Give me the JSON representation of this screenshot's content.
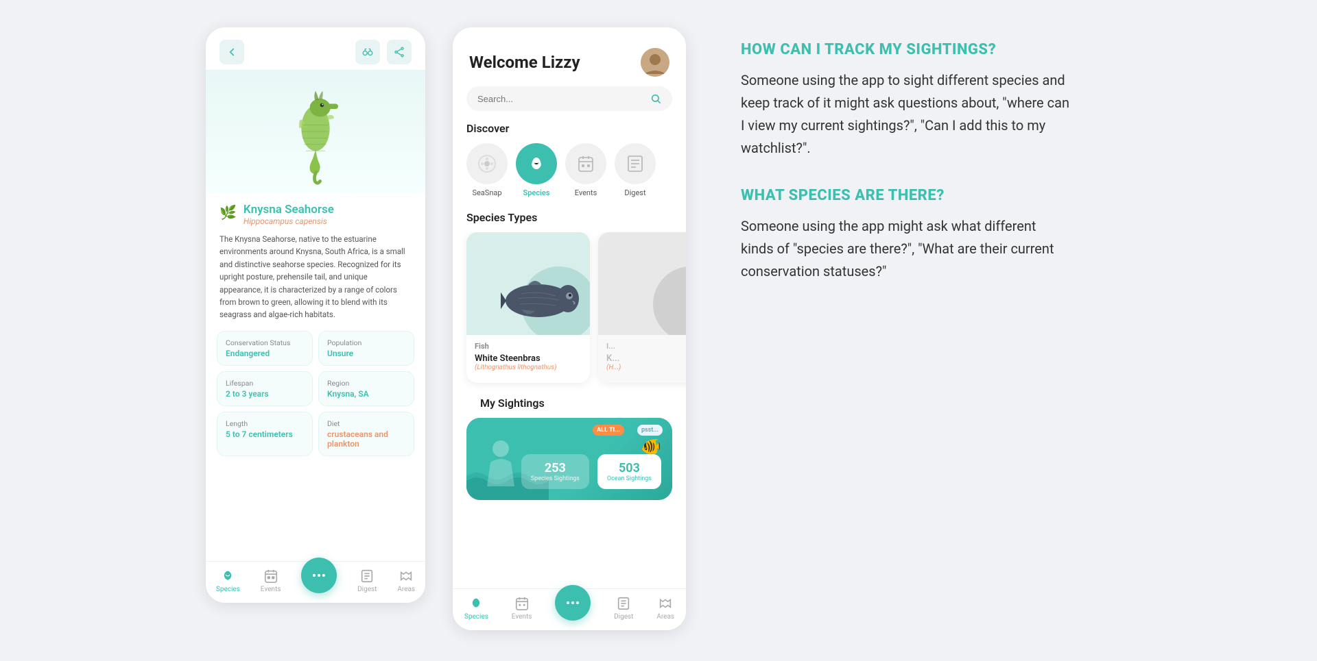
{
  "phone1": {
    "species_name": "Knysna Seahorse",
    "latin_name": "Hippocampus capensis",
    "description": "The Knysna Seahorse, native to the estuarine environments around Knysna, South Africa, is a small and distinctive seahorse species. Recognized for its upright posture, prehensile tail, and unique appearance, it is characterized by a range of colors from brown to green, allowing it to blend with its seagrass and algae-rich habitats.",
    "stats": [
      {
        "label": "Conservation Status",
        "value": "Endangered",
        "color": "teal"
      },
      {
        "label": "Population",
        "value": "Unsure",
        "color": "teal"
      },
      {
        "label": "Lifespan",
        "value": "2 to 3 years",
        "color": "teal"
      },
      {
        "label": "Region",
        "value": "Knysna, SA",
        "color": "teal"
      },
      {
        "label": "Length",
        "value": "5 to 7 centimeters",
        "color": "teal"
      },
      {
        "label": "Diet",
        "value": "crustaceans and plankton",
        "color": "orange"
      }
    ],
    "nav": [
      {
        "label": "Species",
        "active": true
      },
      {
        "label": "Events",
        "active": false
      },
      {
        "label": "Digest",
        "active": false
      },
      {
        "label": "Areas",
        "active": false
      }
    ]
  },
  "phone2": {
    "welcome_text": "Welcome Lizzy",
    "search_placeholder": "Search...",
    "discover_label": "Discover",
    "categories": [
      {
        "label": "SeaSnap",
        "icon": "🔵",
        "active": false
      },
      {
        "label": "Species",
        "icon": "🐢",
        "active": true
      },
      {
        "label": "Events",
        "icon": "📅",
        "active": false
      },
      {
        "label": "Digest",
        "icon": "📖",
        "active": false
      }
    ],
    "species_types_label": "Species Types",
    "species": [
      {
        "name": "Fish",
        "common": "White Steenbras",
        "latin": "Lithognathus lithognathus"
      },
      {
        "name": "I...",
        "common": "K...",
        "latin": "H..."
      }
    ],
    "my_sightings_label": "My Sightings",
    "sightings_stats": [
      {
        "value": "253",
        "label": "Species Sightings",
        "highlight": false
      },
      {
        "value": "503",
        "label": "Ocean Sightings",
        "highlight": true
      }
    ],
    "all_time_label": "ALL TI...",
    "psst_label": "psst...",
    "nav": [
      {
        "label": "Species",
        "active": true
      },
      {
        "label": "Events",
        "active": false
      },
      {
        "label": "Digest",
        "active": false
      },
      {
        "label": "Areas",
        "active": false
      }
    ]
  },
  "faq": [
    {
      "question": "HOW CAN I TRACK MY SIGHTINGS?",
      "answer": "Someone using the app to sight different species and keep track of it might ask questions about, \"where can I view my current sightings?\", \"Can I add this to my watchlist?\"."
    },
    {
      "question": "WHAT SPECIES ARE THERE?",
      "answer": "Someone using the app might ask what different kinds of \"species are there?\", \"What are their current conservation statuses?\""
    }
  ]
}
